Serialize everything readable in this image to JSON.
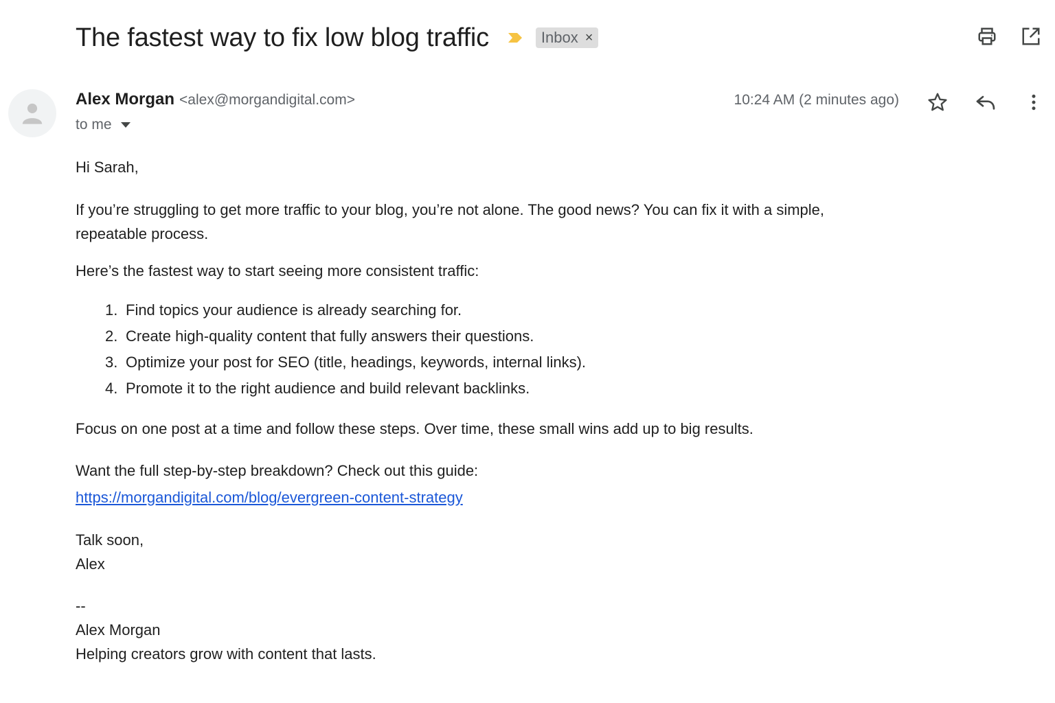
{
  "header": {
    "subject": "The fastest way to fix low blog traffic",
    "label": "Inbox",
    "label_remove_glyph": "×",
    "importance_color": "#f6c343"
  },
  "message": {
    "sender_name": "Alex Morgan",
    "sender_email": "<alex@morgandigital.com>",
    "recipient": "to me",
    "timestamp": "10:24 AM (2 minutes ago)"
  },
  "body": {
    "greeting": "Hi Sarah,",
    "para1_line1": "If you’re struggling to get more traffic to your blog, you’re not alone. The good news? You can fix it with a simple,",
    "para1_line2": "repeatable process.",
    "para2": "Here’s the fastest way to start seeing more consistent traffic:",
    "steps": [
      {
        "num": "1.",
        "text": "Find topics your audience is already searching for."
      },
      {
        "num": "2.",
        "text": "Create high-quality content that fully answers their questions."
      },
      {
        "num": "3.",
        "text": "Optimize your post for SEO (title, headings, keywords, internal links)."
      },
      {
        "num": "4.",
        "text": "Promote it to the right audience and build relevant backlinks."
      }
    ],
    "para3": "Focus on one post at a time and follow these steps. Over time, these small wins add up to big results.",
    "para4": "Want the full step-by-step breakdown? Check out this guide:",
    "link": "https://morgandigital.com/blog/evergreen-content-strategy",
    "closing": "Talk soon,",
    "closing_name": "Alex",
    "sig_separator": "--",
    "sig_name": "Alex Morgan",
    "sig_tagline": "Helping creators grow with content that lasts."
  },
  "colors": {
    "link": "#1a57d8",
    "secondary_text": "#5f6368",
    "chip_bg": "#dddddd"
  },
  "icons": {
    "print": "print-icon",
    "open_new_window": "open-in-new-window-icon",
    "star": "star-icon",
    "reply": "reply-icon",
    "more": "more-vert-icon",
    "avatar": "avatar-person-icon",
    "caret": "caret-down-icon",
    "importance": "importance-marker-icon"
  }
}
